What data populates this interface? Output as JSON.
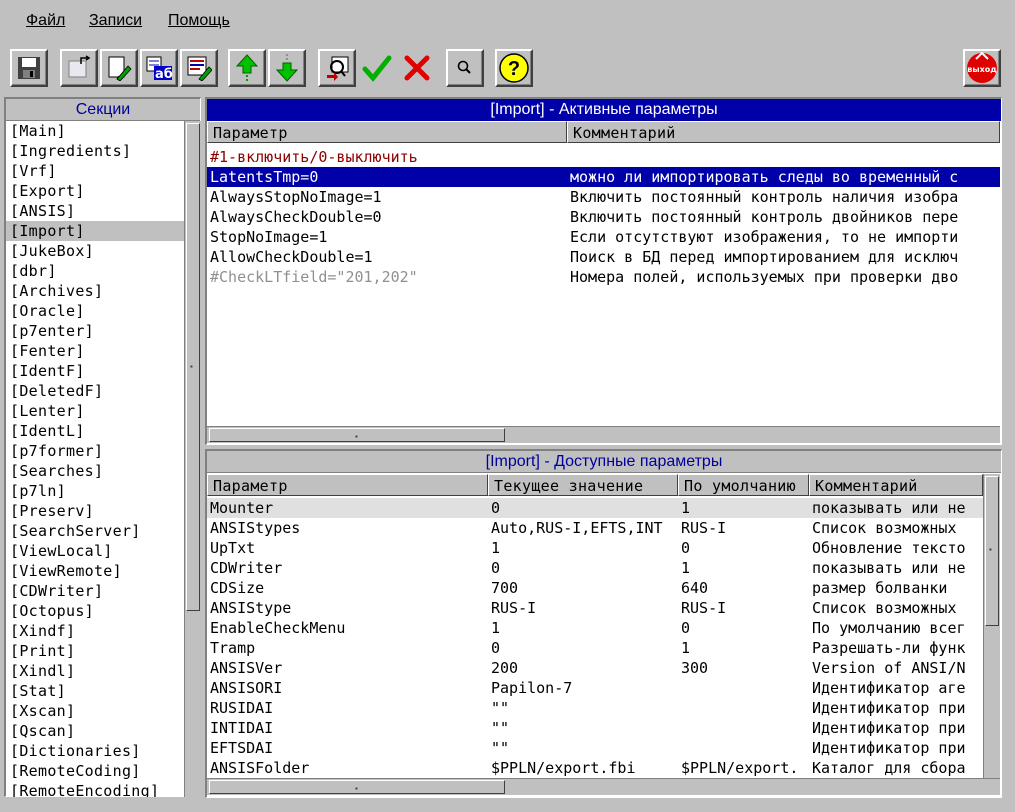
{
  "menu": {
    "file": "Файл",
    "records": "Записи",
    "help": "Помощь"
  },
  "toolbar": {
    "icons": [
      "save-icon",
      "new-record-icon",
      "edit-icon",
      "spell-check-icon",
      "edit-list-icon",
      "move-up-icon",
      "move-down-icon",
      "import-icon",
      "apply-icon",
      "cancel-icon",
      "search-icon",
      "help-icon",
      "exit-icon"
    ],
    "exit_label": "выход",
    "help_label": "?"
  },
  "sections": {
    "header": "Секции",
    "selected": "[Import]",
    "items": [
      "[Main]",
      "[Ingredients]",
      "[Vrf]",
      "[Export]",
      "[ANSIS]",
      "[Import]",
      "[JukeBox]",
      "[dbr]",
      "[Archives]",
      "[Oracle]",
      "[p7enter]",
      "[Fenter]",
      "[IdentF]",
      "[DeletedF]",
      "[Lenter]",
      "[IdentL]",
      "[p7former]",
      "[Searches]",
      "[p7ln]",
      "[Preserv]",
      "[SearchServer]",
      "[ViewLocal]",
      "[ViewRemote]",
      "[CDWriter]",
      "[Octopus]",
      "[Xindf]",
      "[Print]",
      "[Xindl]",
      "[Stat]",
      "[Xscan]",
      "[Qscan]",
      "[Dictionaries]",
      "[RemoteCoding]",
      "[RemoteEncoding]"
    ]
  },
  "active": {
    "title": "[Import] - Активные параметры",
    "col_param": "Параметр",
    "col_comment": "Комментарий",
    "comment_line": "#1-включить/0-выключить",
    "rows": [
      {
        "param": "LatentsTmp=0",
        "comment": "можно ли импортировать следы во временный с",
        "selected": true
      },
      {
        "param": "AlwaysStopNoImage=1",
        "comment": "Включить постоянный контроль наличия изобра"
      },
      {
        "param": "AlwaysCheckDouble=0",
        "comment": "Включить постоянный контроль двойников пере"
      },
      {
        "param": "StopNoImage=1",
        "comment": "Если отсутствуют изображения, то не импорти"
      },
      {
        "param": "AllowCheckDouble=1",
        "comment": "Поиск в БД перед импортированием для исключ"
      },
      {
        "param": "#CheckLTfield=\"201,202\"",
        "comment": "Номера полей, используемых при проверки дво",
        "disabled": true
      }
    ],
    "colors": {
      "comment": "#8b0000",
      "disabled": "#909090",
      "selected_bg": "#0000a8"
    }
  },
  "available": {
    "title": "[Import] - Доступные параметры",
    "col_param": "Параметр",
    "col_current": "Текущее значение",
    "col_default": "По умолчанию",
    "col_comment": "Комментарий",
    "rows": [
      {
        "param": "Mounter",
        "current": "0",
        "default": "1",
        "comment": "показывать или не"
      },
      {
        "param": "ANSIStypes",
        "current": "Auto,RUS-I,EFTS,INT",
        "default": "RUS-I",
        "comment": "Список возможных"
      },
      {
        "param": "UpTxt",
        "current": "1",
        "default": "0",
        "comment": "Обновление тексто"
      },
      {
        "param": "CDWriter",
        "current": "0",
        "default": "1",
        "comment": "показывать или не"
      },
      {
        "param": "CDSize",
        "current": "700",
        "default": "640",
        "comment": "размер болванки"
      },
      {
        "param": "ANSIStype",
        "current": "RUS-I",
        "default": "RUS-I",
        "comment": "Список возможных"
      },
      {
        "param": "EnableCheckMenu",
        "current": "1",
        "default": "0",
        "comment": "По умолчанию всег"
      },
      {
        "param": "Tramp",
        "current": "0",
        "default": "1",
        "comment": "Разрешать-ли функ"
      },
      {
        "param": "ANSISVer",
        "current": "200",
        "default": "300",
        "comment": "Version of ANSI/N"
      },
      {
        "param": "ANSISORI",
        "current": "Papilon-7",
        "default": "",
        "comment": "Идентификатор аге"
      },
      {
        "param": "RUSIDAI",
        "current": "\"\"",
        "default": "",
        "comment": "Идентификатор при"
      },
      {
        "param": "INTIDAI",
        "current": "\"\"",
        "default": "",
        "comment": "Идентификатор при"
      },
      {
        "param": "EFTSDAI",
        "current": "\"\"",
        "default": "",
        "comment": "Идентификатор при"
      },
      {
        "param": "ANSISFolder",
        "current": "$PPLN/export.fbi",
        "default": "$PPLN/export.",
        "comment": "Каталог для сбора"
      }
    ]
  }
}
